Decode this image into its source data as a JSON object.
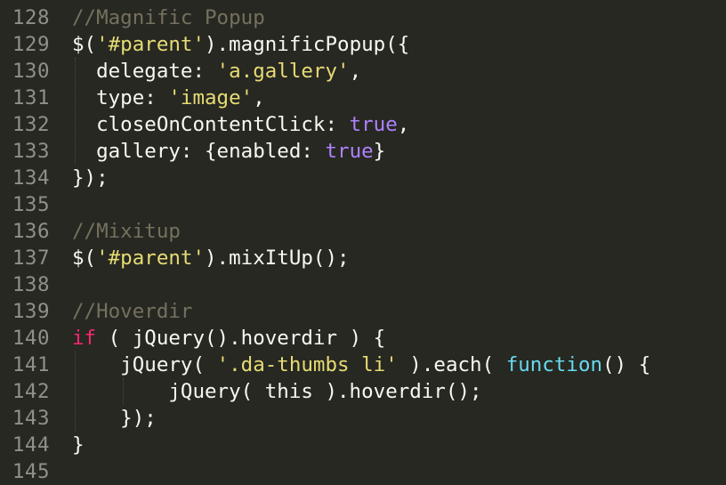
{
  "theme": {
    "background": "#272822",
    "gutter_text": "#8f908a",
    "plain": "#f8f8f2",
    "comment": "#75715e",
    "string": "#e6db74",
    "keyword": "#f92672",
    "constant": "#ae81ff",
    "builtin": "#66d9ef"
  },
  "lines": [
    {
      "number": "128",
      "tokens": [
        {
          "type": "comment",
          "text": "//Magnific Popup"
        }
      ]
    },
    {
      "number": "129",
      "tokens": [
        {
          "type": "plain",
          "text": "$("
        },
        {
          "type": "string",
          "text": "'#parent'"
        },
        {
          "type": "plain",
          "text": ").magnificPopup({"
        }
      ]
    },
    {
      "number": "130",
      "tokens": [
        {
          "type": "plain",
          "text": "  delegate: "
        },
        {
          "type": "string",
          "text": "'a.gallery'"
        },
        {
          "type": "plain",
          "text": ","
        }
      ]
    },
    {
      "number": "131",
      "tokens": [
        {
          "type": "plain",
          "text": "  type: "
        },
        {
          "type": "string",
          "text": "'image'"
        },
        {
          "type": "plain",
          "text": ","
        }
      ]
    },
    {
      "number": "132",
      "tokens": [
        {
          "type": "plain",
          "text": "  closeOnContentClick: "
        },
        {
          "type": "constant",
          "text": "true"
        },
        {
          "type": "plain",
          "text": ","
        }
      ]
    },
    {
      "number": "133",
      "tokens": [
        {
          "type": "plain",
          "text": "  gallery: {enabled: "
        },
        {
          "type": "constant",
          "text": "true"
        },
        {
          "type": "plain",
          "text": "}"
        }
      ]
    },
    {
      "number": "134",
      "tokens": [
        {
          "type": "plain",
          "text": "});"
        }
      ]
    },
    {
      "number": "135",
      "tokens": []
    },
    {
      "number": "136",
      "tokens": [
        {
          "type": "comment",
          "text": "//Mixitup"
        }
      ]
    },
    {
      "number": "137",
      "tokens": [
        {
          "type": "plain",
          "text": "$("
        },
        {
          "type": "string",
          "text": "'#parent'"
        },
        {
          "type": "plain",
          "text": ").mixItUp();"
        }
      ]
    },
    {
      "number": "138",
      "tokens": []
    },
    {
      "number": "139",
      "tokens": [
        {
          "type": "comment",
          "text": "//Hoverdir"
        }
      ]
    },
    {
      "number": "140",
      "tokens": [
        {
          "type": "keyword",
          "text": "if"
        },
        {
          "type": "plain",
          "text": " ( jQuery().hoverdir ) {"
        }
      ]
    },
    {
      "number": "141",
      "tokens": [
        {
          "type": "plain",
          "text": "    jQuery( "
        },
        {
          "type": "string",
          "text": "'.da-thumbs li'"
        },
        {
          "type": "plain",
          "text": " ).each( "
        },
        {
          "type": "builtin",
          "text": "function"
        },
        {
          "type": "plain",
          "text": "() {"
        }
      ]
    },
    {
      "number": "142",
      "tokens": [
        {
          "type": "plain",
          "text": "        jQuery( this ).hoverdir();"
        }
      ]
    },
    {
      "number": "143",
      "tokens": [
        {
          "type": "plain",
          "text": "    });"
        }
      ]
    },
    {
      "number": "144",
      "tokens": [
        {
          "type": "plain",
          "text": "}"
        }
      ]
    },
    {
      "number": "145",
      "tokens": []
    }
  ]
}
